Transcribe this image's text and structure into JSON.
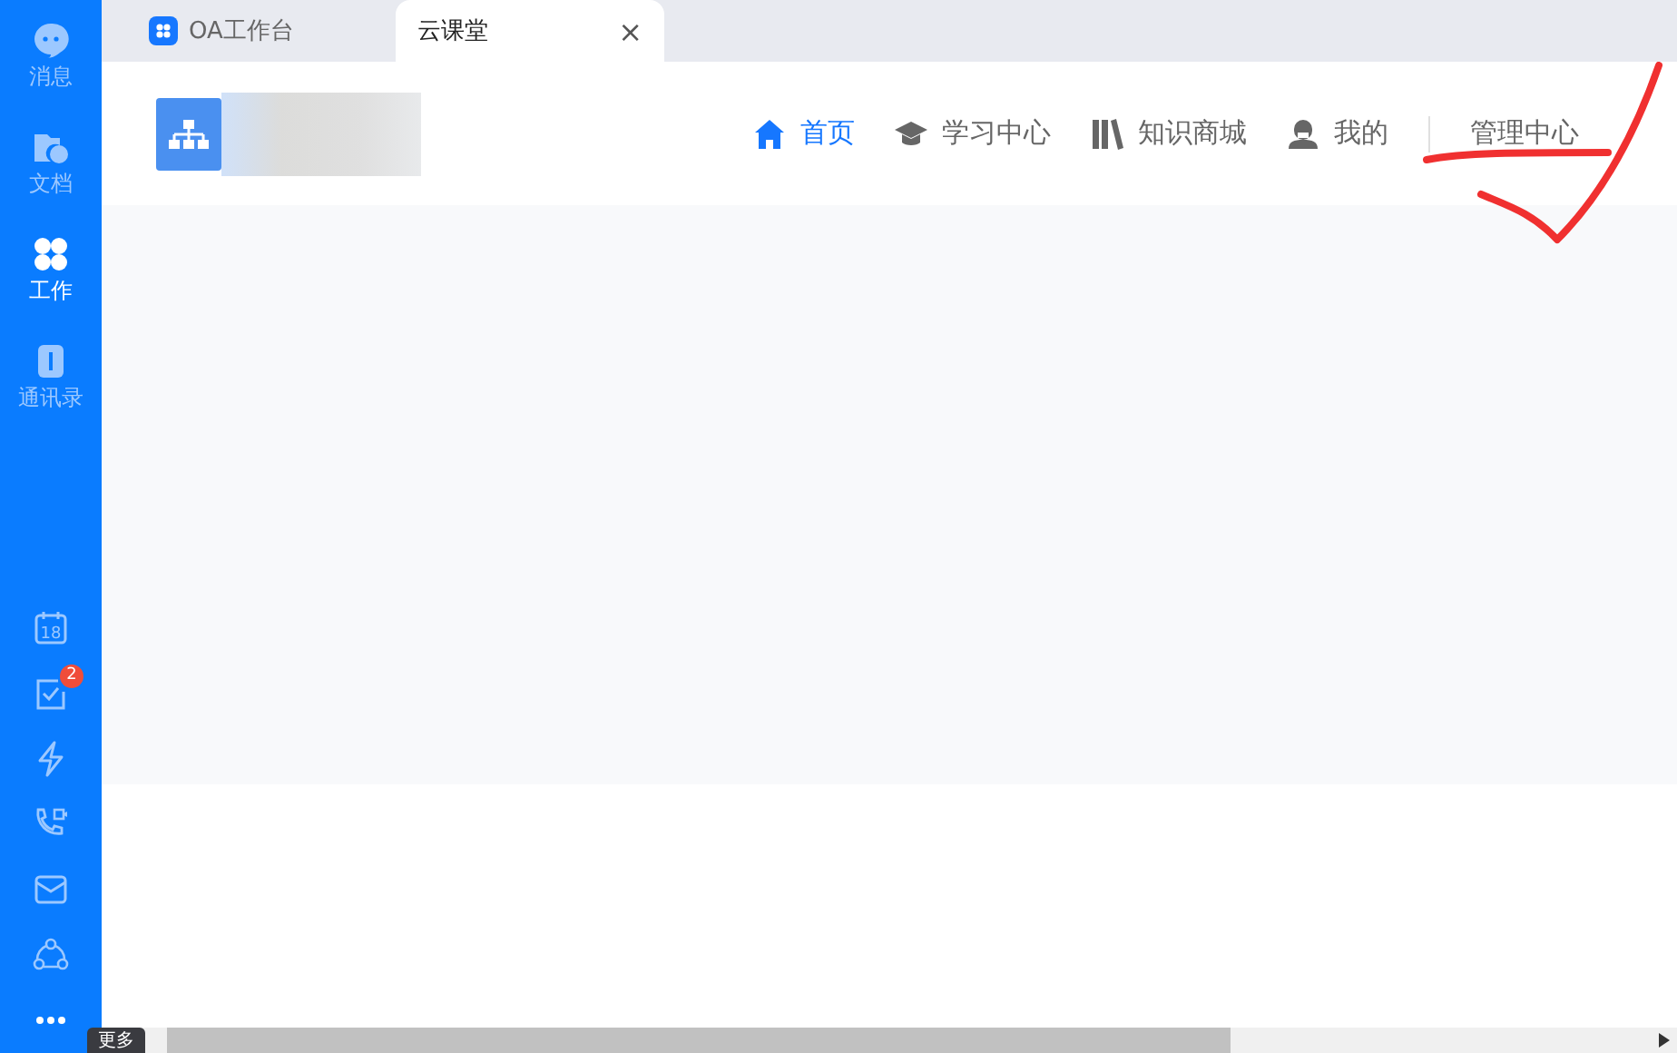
{
  "sidebar": {
    "top_items": [
      {
        "label": "消息",
        "kind": "chat",
        "selected": false
      },
      {
        "label": "文档",
        "kind": "folder",
        "selected": false
      },
      {
        "label": "工作",
        "kind": "grid",
        "selected": true
      },
      {
        "label": "通讯录",
        "kind": "book",
        "selected": false
      }
    ],
    "bottom_items": [
      {
        "kind": "calendar",
        "text": "18"
      },
      {
        "kind": "todo",
        "badge": "2"
      },
      {
        "kind": "bolt"
      },
      {
        "kind": "phone"
      },
      {
        "kind": "mail"
      },
      {
        "kind": "network"
      },
      {
        "kind": "more"
      }
    ],
    "tooltip": "更多"
  },
  "tabs": [
    {
      "label": "OA工作台",
      "selected": false
    },
    {
      "label": "云课堂",
      "selected": true,
      "close": "×"
    }
  ],
  "nav": [
    {
      "label": "首页",
      "kind": "home",
      "selected": true
    },
    {
      "label": "学习中心",
      "kind": "cap",
      "selected": false
    },
    {
      "label": "知识商城",
      "kind": "books",
      "selected": false
    },
    {
      "label": "我的",
      "kind": "user",
      "selected": false
    },
    {
      "label": "管理中心",
      "kind": "plain",
      "selected": false
    }
  ]
}
